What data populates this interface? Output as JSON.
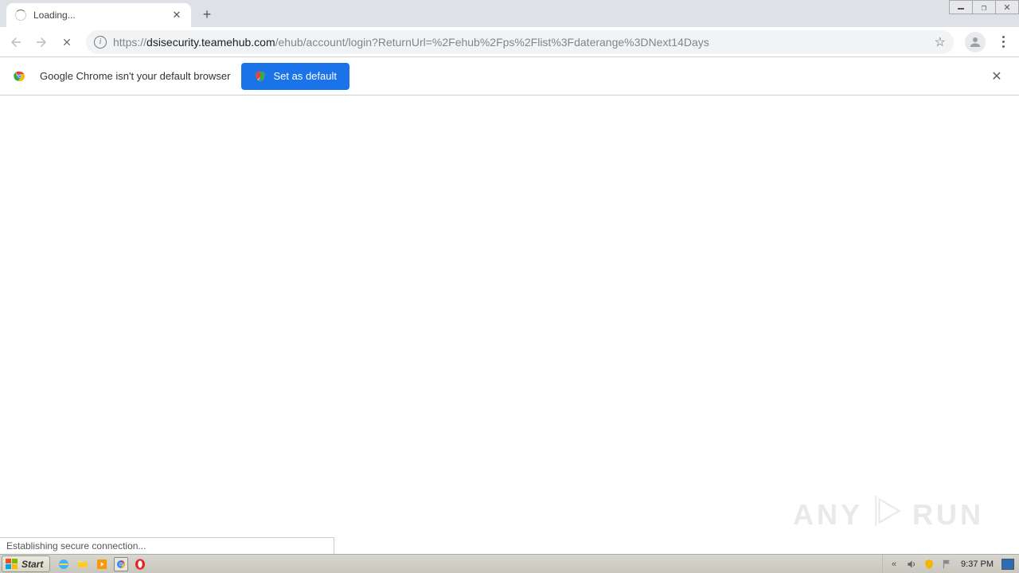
{
  "browser": {
    "tab": {
      "title": "Loading..."
    },
    "url": {
      "scheme": "https://",
      "host": "dsisecurity.teamehub.com",
      "path": "/ehub/account/login?ReturnUrl=%2Fehub%2Fps%2Flist%3Fdaterange%3DNext14Days"
    }
  },
  "infobar": {
    "message": "Google Chrome isn't your default browser",
    "button": "Set as default"
  },
  "page_status": "Establishing secure connection...",
  "watermark": {
    "left": "ANY",
    "right": "RUN"
  },
  "taskbar": {
    "start": "Start",
    "clock": "9:37 PM"
  }
}
